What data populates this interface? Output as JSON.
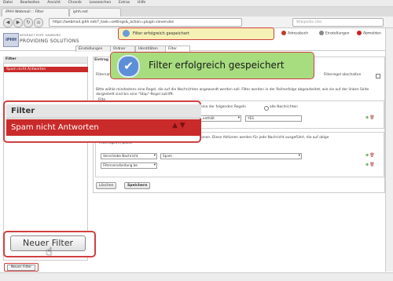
{
  "browser": {
    "menu": [
      "Datei",
      "Bearbeiten",
      "Ansicht",
      "Chronik",
      "Lesezeichen",
      "Extras",
      "Hilfe"
    ],
    "tabs": [
      "iPHH Webmail :: Filter",
      "iphh.net"
    ],
    "url": "https://webmail.iphh.net/?_task=settings&_action=plugin.sieverules",
    "search_placeholder": "Wikipedia (de)"
  },
  "header": {
    "logo_mark": "iPHH",
    "logo_line1": "INTERNET PORT HAMBURG",
    "logo_line2": "PROVIDING SOLUTIONS",
    "nav": [
      {
        "label": "Adressbuch",
        "color": "#c0392b"
      },
      {
        "label": "Einstellungen",
        "color": "#888888"
      },
      {
        "label": "Abmelden",
        "color": "#cc2222"
      }
    ]
  },
  "tabs": [
    "Einstellungen",
    "Ordner",
    "Identitäten",
    "Filter"
  ],
  "left_panel": {
    "title": "Filter",
    "selected_item": "Spam nicht Antworten",
    "new_filter_label": "Neuer Filter"
  },
  "main": {
    "title": "Eintrag",
    "filter_name_label": "Filtername",
    "disable_label": "Filterregel abschalten",
    "intro": "Bitte wähle mindestens eine Regel, die auf die Nachrichten angewandt werden soll. Filter werden in der Reihenfolge abgearbeitet, wie sie auf der linken Seite dargestellt sind bis eine \"Stop\"-Regel zutrifft.",
    "rules_legend": "Filte",
    "match_option_any": "eine der folgenden Regeln",
    "match_option_all": "alle Nachrichten",
    "rule_operator": "enthält",
    "rule_value": "YES",
    "actions_intro": "ionen. Diese Aktionen werden für jede Nachricht ausgeführt, die auf obige",
    "actions_intro2": "Filterregel(n) passt.",
    "action1_type": "Verschiebe Nachricht",
    "action1_target": "Spam",
    "action2_type": "Filterverarbeitung be",
    "delete_label": "Löschen",
    "save_label": "Speichern"
  },
  "notification": {
    "small": "Filter erfolgreich gespeichert",
    "big": "Filter erfolgreich gespeichert"
  },
  "colors": {
    "accent_red": "#c92a2a",
    "callout_border": "#d04040",
    "notify_green": "#a7dc7f"
  }
}
